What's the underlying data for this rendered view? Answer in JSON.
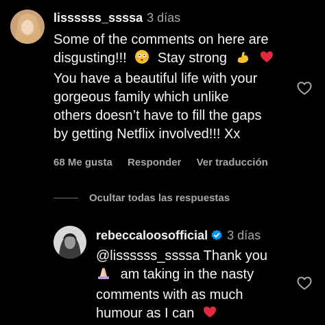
{
  "comment": {
    "username": "lissssss_ssssa",
    "time": "3 días",
    "lines": [
      "Some of the comments on here are",
      "disgusting!!!",
      "Stay strong",
      "You have a beautiful life with your",
      "gorgeous family which unlike",
      "others doesn’t have to fill the gaps",
      "by getting Netflix involved!!! Xx"
    ],
    "likes": "68 Me gusta",
    "reply_label": "Responder",
    "translate_label": "Ver traducción"
  },
  "hide_replies_label": "Ocultar todas las respuestas",
  "reply": {
    "username": "rebeccaloosofficial",
    "time": "3 días",
    "mention": "@lissssss_ssssa",
    "lines": [
      "Thank you",
      "am taking in the nasty",
      "comments with as much",
      "humour as I can"
    ]
  },
  "icons": {
    "flushed": "flushed-face-emoji",
    "muscle": "flexed-biceps-emoji",
    "heart": "red-heart-emoji",
    "pray": "folded-hands-emoji",
    "like": "heart-outline-icon",
    "verified": "verified-badge-icon"
  },
  "colors": {
    "background": "#000000",
    "text": "#f5f5f5",
    "muted": "#a8a8a8",
    "verified": "#0095f6",
    "heart": "#ff3040"
  }
}
